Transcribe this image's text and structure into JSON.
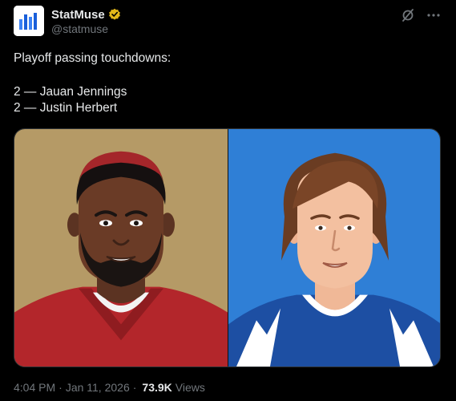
{
  "author": {
    "display_name": "StatMuse",
    "handle": "@statmuse",
    "verified_icon": "verified-badge-icon",
    "avatar_icon": "statmuse-bars-logo",
    "brand_color": "#1a5fd9"
  },
  "actions": {
    "grok_icon": "grok-icon",
    "more_icon": "more-icon"
  },
  "tweet": {
    "heading": "Playoff passing touchdowns:",
    "lines": [
      "2 — Jauan Jennings",
      "2 — Justin Herbert"
    ]
  },
  "media": {
    "left_bg": "#b59a66",
    "right_bg": "#2f7fd6"
  },
  "meta": {
    "time": "4:04 PM",
    "date": "Jan 11, 2026",
    "views_count": "73.9K",
    "views_label": "Views"
  }
}
